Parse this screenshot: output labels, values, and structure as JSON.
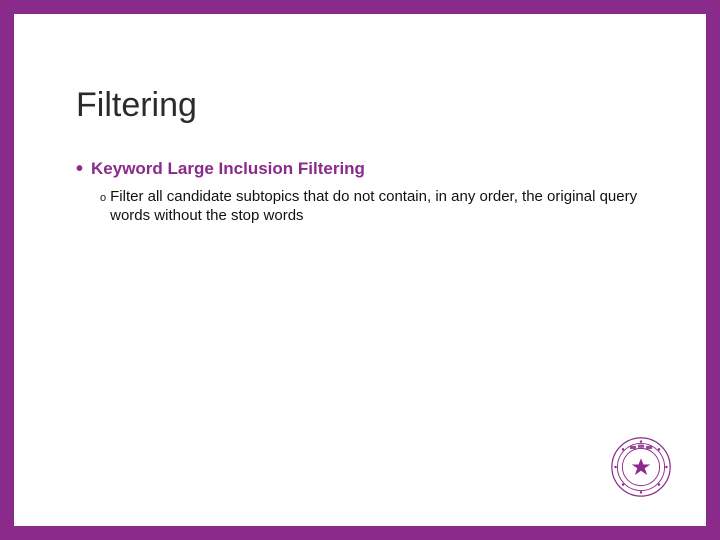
{
  "slide": {
    "title": "Filtering",
    "bullet1": {
      "label": "Keyword Large Inclusion Filtering",
      "sub1": "Filter all candidate subtopics that do not contain, in any order, the original query words without the stop words"
    }
  },
  "colors": {
    "accent": "#8a2a8a"
  }
}
